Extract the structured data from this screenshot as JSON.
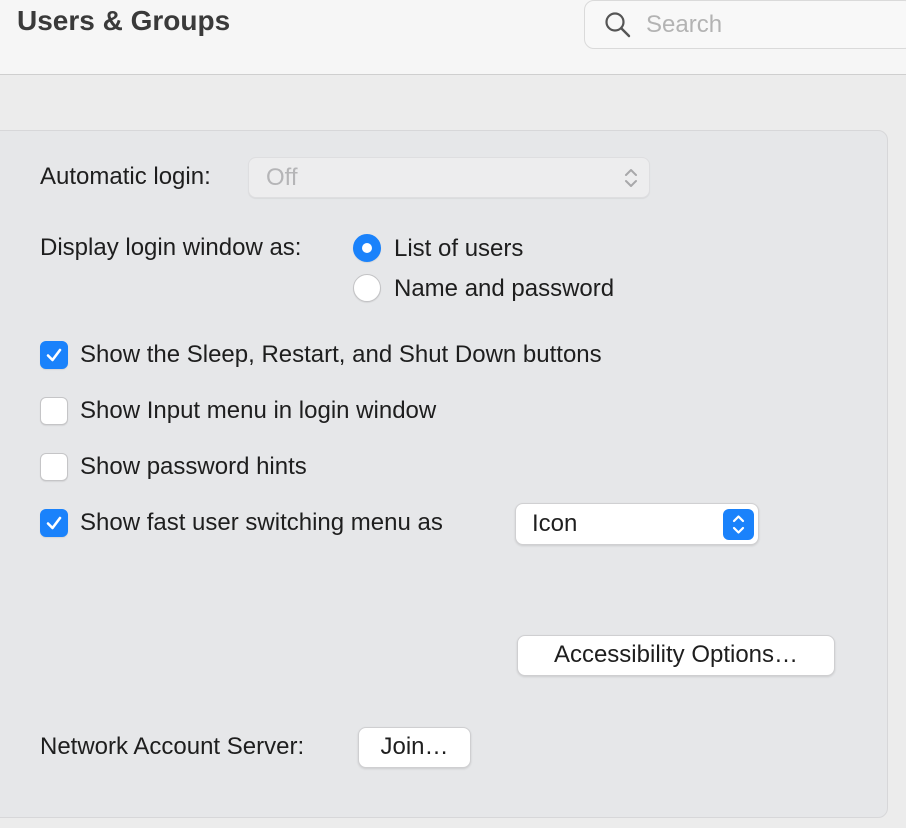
{
  "window": {
    "title": "Users & Groups"
  },
  "search": {
    "placeholder": "Search",
    "value": ""
  },
  "login_options": {
    "automatic_login": {
      "label": "Automatic login:",
      "value": "Off",
      "enabled": false
    },
    "display_login_window": {
      "label": "Display login window as:",
      "options": [
        {
          "label": "List of users",
          "selected": true
        },
        {
          "label": "Name and password",
          "selected": false
        }
      ]
    },
    "checkboxes": [
      {
        "label": "Show the Sleep, Restart, and Shut Down buttons",
        "checked": true
      },
      {
        "label": "Show Input menu in login window",
        "checked": false
      },
      {
        "label": "Show password hints",
        "checked": false
      },
      {
        "label": "Show fast user switching menu as",
        "checked": true
      }
    ],
    "fast_user_switching_menu": {
      "value": "Icon"
    },
    "accessibility_button": "Accessibility Options…",
    "network_account_server": {
      "label": "Network Account Server:",
      "button": "Join…"
    }
  },
  "colors": {
    "accent": "#1a82fb",
    "panel": "#e6e7e9",
    "toolbar": "#f6f6f6"
  }
}
